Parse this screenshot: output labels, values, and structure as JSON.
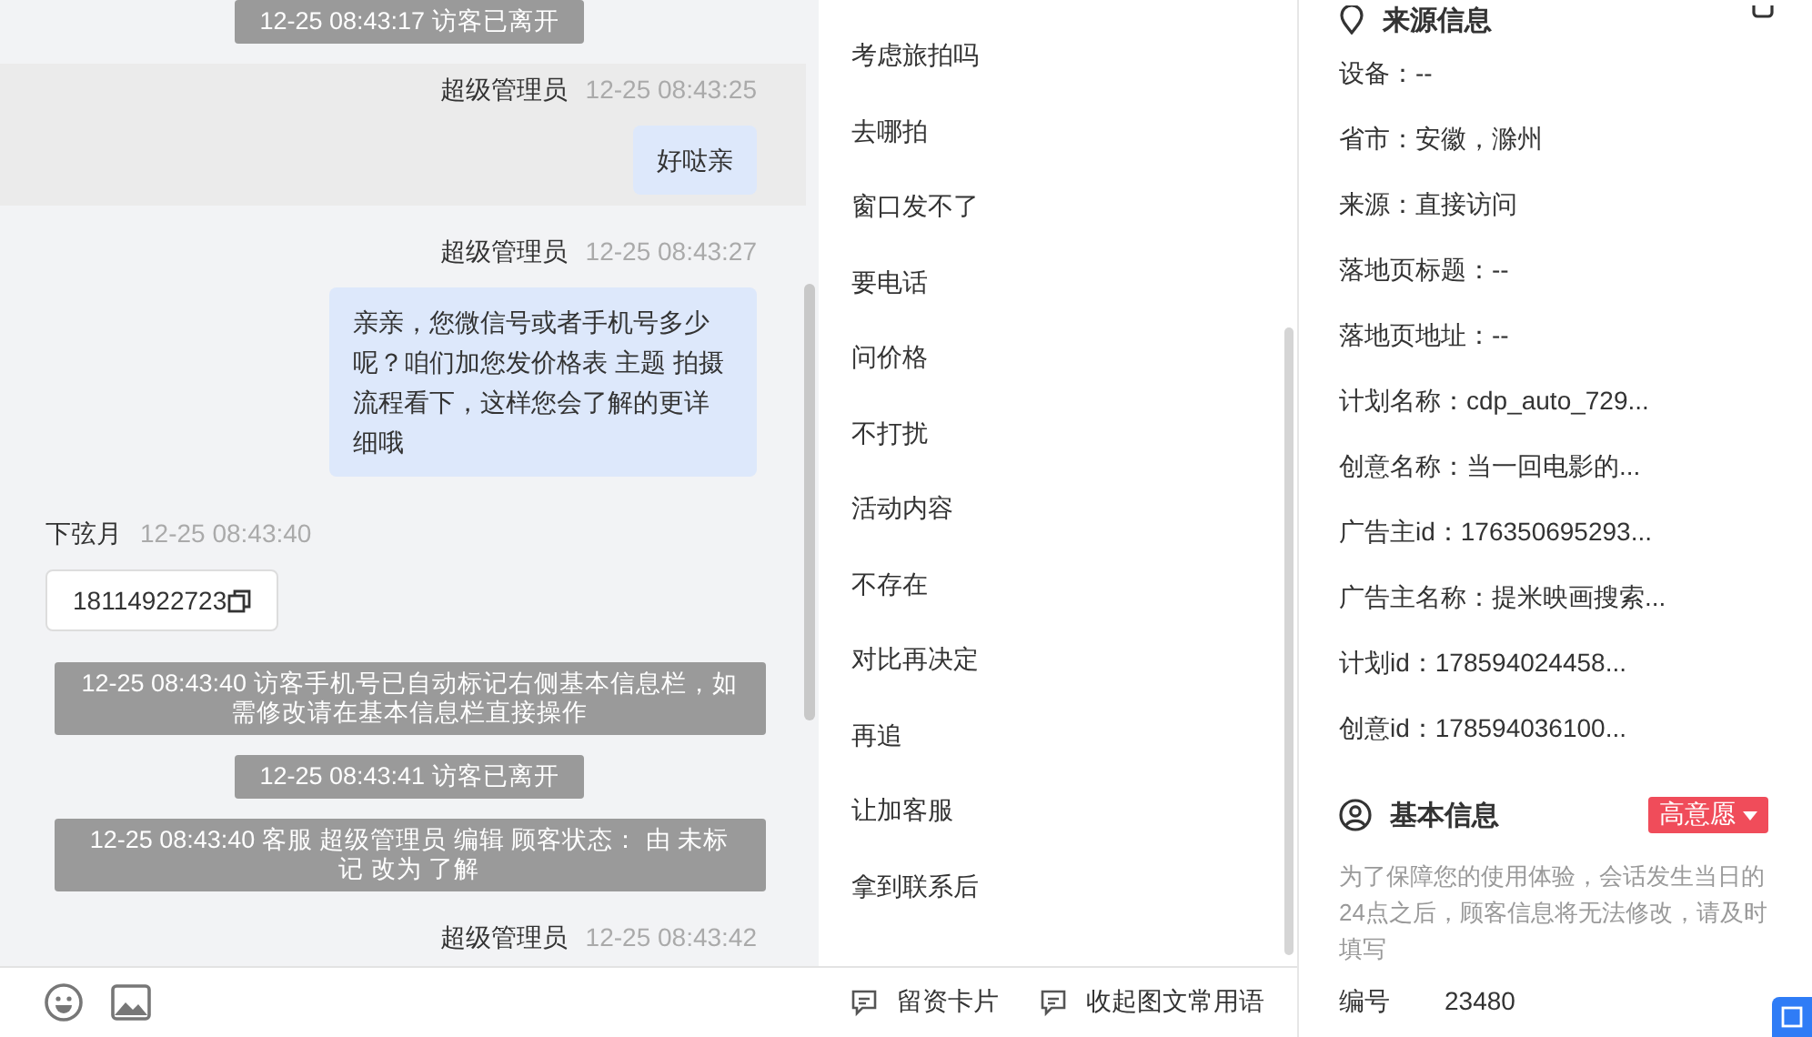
{
  "chat": {
    "messages": [
      {
        "kind": "notice",
        "text": "12-25 08:43:17 访客已离开"
      },
      {
        "kind": "agent",
        "sender": "超级管理员",
        "time": "12-25 08:43:25",
        "text": "好哒亲",
        "highlighted": true
      },
      {
        "kind": "agent",
        "sender": "超级管理员",
        "time": "12-25 08:43:27",
        "text": "亲亲，您微信号或者手机号多少呢？咱们加您发价格表 主题 拍摄流程看下，这样您会了解的更详细哦",
        "highlighted": false
      },
      {
        "kind": "visitor",
        "sender": "下弦月",
        "time": "12-25 08:43:40",
        "text": "18114922723"
      },
      {
        "kind": "notice",
        "text": "12-25 08:43:40 访客手机号已自动标记右侧基本信息栏，如需修改请在基本信息栏直接操作"
      },
      {
        "kind": "notice",
        "text": "12-25 08:43:41 访客已离开"
      },
      {
        "kind": "notice",
        "text": "12-25 08:43:40 客服 超级管理员 编辑 顾客状态： 由 未标记 改为 了解"
      },
      {
        "kind": "header",
        "sender": "超级管理员",
        "time": "12-25 08:43:42"
      }
    ]
  },
  "quick_replies": {
    "items": [
      "考虑旅拍吗",
      "去哪拍",
      "窗口发不了",
      "要电话",
      "问价格",
      "不打扰",
      "活动内容",
      "不存在",
      "对比再决定",
      "再追",
      "让加客服",
      "拿到联系后"
    ],
    "toolbar": [
      "留资卡片",
      "收起图文常用语"
    ]
  },
  "info": {
    "source": {
      "title": "来源信息",
      "fields": [
        "设备：--",
        "省市：安徽，滁州",
        "来源：直接访问",
        "落地页标题：--",
        "落地页地址：--",
        "计划名称：cdp_auto_729...",
        "创意名称：当一回电影的...",
        "广告主id：176350695293...",
        "广告主名称：提米映画搜索...",
        "计划id：178594024458...",
        "创意id：178594036100..."
      ]
    },
    "basic": {
      "title": "基本信息",
      "intent": "高意愿",
      "note": "为了保障您的使用体验，会话发生当日的24点之后，顾客信息将无法修改，请及时填写",
      "fields": [
        {
          "label": "编号",
          "value": "23480"
        }
      ]
    }
  }
}
